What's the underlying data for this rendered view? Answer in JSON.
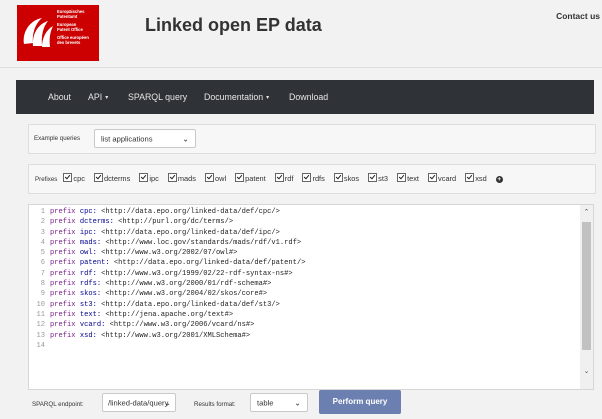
{
  "header": {
    "logo_lines": [
      "Europäisches",
      "Patentamt",
      "European",
      "Patent Office",
      "Office européen",
      "des brevets"
    ],
    "title": "Linked open EP data",
    "contact": "Contact us"
  },
  "nav": {
    "items": [
      {
        "label": "About",
        "dropdown": false
      },
      {
        "label": "API",
        "dropdown": true
      },
      {
        "label": "SPARQL query",
        "dropdown": false
      },
      {
        "label": "Documentation",
        "dropdown": true
      },
      {
        "label": "Download",
        "dropdown": false
      }
    ],
    "caret": "▾"
  },
  "examples": {
    "label": "Example queries",
    "selected": "list applications",
    "chevron": "⌄"
  },
  "prefixes": {
    "label": "Prefixes",
    "items": [
      "cpc",
      "dcterms",
      "ipc",
      "mads",
      "owl",
      "patent",
      "rdf",
      "rdfs",
      "skos",
      "st3",
      "text",
      "vcard",
      "xsd"
    ],
    "checked": true,
    "add_icon": "+"
  },
  "editor": {
    "lines": [
      {
        "num": "1",
        "kw": "prefix",
        "name": "cpc:",
        "uri": "<http://data.epo.org/linked-data/def/cpc/>"
      },
      {
        "num": "2",
        "kw": "prefix",
        "name": "dcterms:",
        "uri": "<http://purl.org/dc/terms/>"
      },
      {
        "num": "3",
        "kw": "prefix",
        "name": "ipc:",
        "uri": "<http://data.epo.org/linked-data/def/ipc/>"
      },
      {
        "num": "4",
        "kw": "prefix",
        "name": "mads:",
        "uri": "<http://www.loc.gov/standards/mads/rdf/v1.rdf>"
      },
      {
        "num": "5",
        "kw": "prefix",
        "name": "owl:",
        "uri": "<http://www.w3.org/2002/07/owl#>"
      },
      {
        "num": "6",
        "kw": "prefix",
        "name": "patent:",
        "uri": "<http://data.epo.org/linked-data/def/patent/>"
      },
      {
        "num": "7",
        "kw": "prefix",
        "name": "rdf:",
        "uri": "<http://www.w3.org/1999/02/22-rdf-syntax-ns#>"
      },
      {
        "num": "8",
        "kw": "prefix",
        "name": "rdfs:",
        "uri": "<http://www.w3.org/2000/01/rdf-schema#>"
      },
      {
        "num": "9",
        "kw": "prefix",
        "name": "skos:",
        "uri": "<http://www.w3.org/2004/02/skos/core#>"
      },
      {
        "num": "10",
        "kw": "prefix",
        "name": "st3:",
        "uri": "<http://data.epo.org/linked-data/def/st3/>"
      },
      {
        "num": "11",
        "kw": "prefix",
        "name": "text:",
        "uri": "<http://jena.apache.org/text#>"
      },
      {
        "num": "12",
        "kw": "prefix",
        "name": "vcard:",
        "uri": "<http://www.w3.org/2006/vcard/ns#>"
      },
      {
        "num": "13",
        "kw": "prefix",
        "name": "xsd:",
        "uri": "<http://www.w3.org/2001/XMLSchema#>"
      },
      {
        "num": "14",
        "kw": "",
        "name": "",
        "uri": ""
      }
    ],
    "scroll_up": "⌃",
    "scroll_down": "⌄"
  },
  "query_bar": {
    "endpoint_label": "SPARQL endpoint:",
    "endpoint_value": "/linked-data/query",
    "format_label": "Results format:",
    "format_value": "table",
    "chevron": "⌄",
    "submit_label": "Perform query"
  },
  "colors": {
    "brand_red": "#cc0000",
    "navbar_bg": "#2f3236",
    "button_bg": "#6b7fb0"
  }
}
